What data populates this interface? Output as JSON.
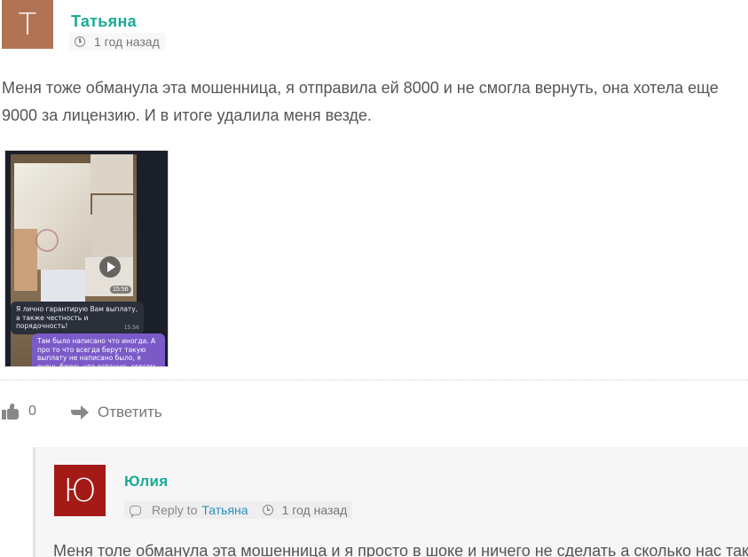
{
  "comment": {
    "avatar_letter": "T",
    "author": "Татьяна",
    "time": "1 год назад",
    "text": "Меня тоже обманула эта мошенница, я отправила ей 8000 и не смогла вернуть, она хотела еще 9000 за лицензию. И в итоге удалила меня везде.",
    "attachment": {
      "video_time": "15:56",
      "bubble_in_text": "Я лично гарантирую Вам выплату, а также честность и порядочность!",
      "bubble_in_time": "15:56",
      "bubble_out_text": "Там было написано что иногда. А про то что всегда берут такую выплату не написано было, я очень боюсь что останусь совсем без"
    },
    "likes": "0",
    "reply_label": "Ответить"
  },
  "reply": {
    "avatar_letter": "Ю",
    "author": "Юлия",
    "reply_to_label": "Reply to",
    "reply_to_name": "Татьяна",
    "time": "1 год назад",
    "text": "Меня толе обманула эта мошенница и я просто в шоке и ничего не сделать а сколько нас таки"
  },
  "colors": {
    "author": "#1aab97",
    "avatar_t": "#b07454",
    "avatar_yu": "#a41a17",
    "link": "#2a8fbd"
  }
}
